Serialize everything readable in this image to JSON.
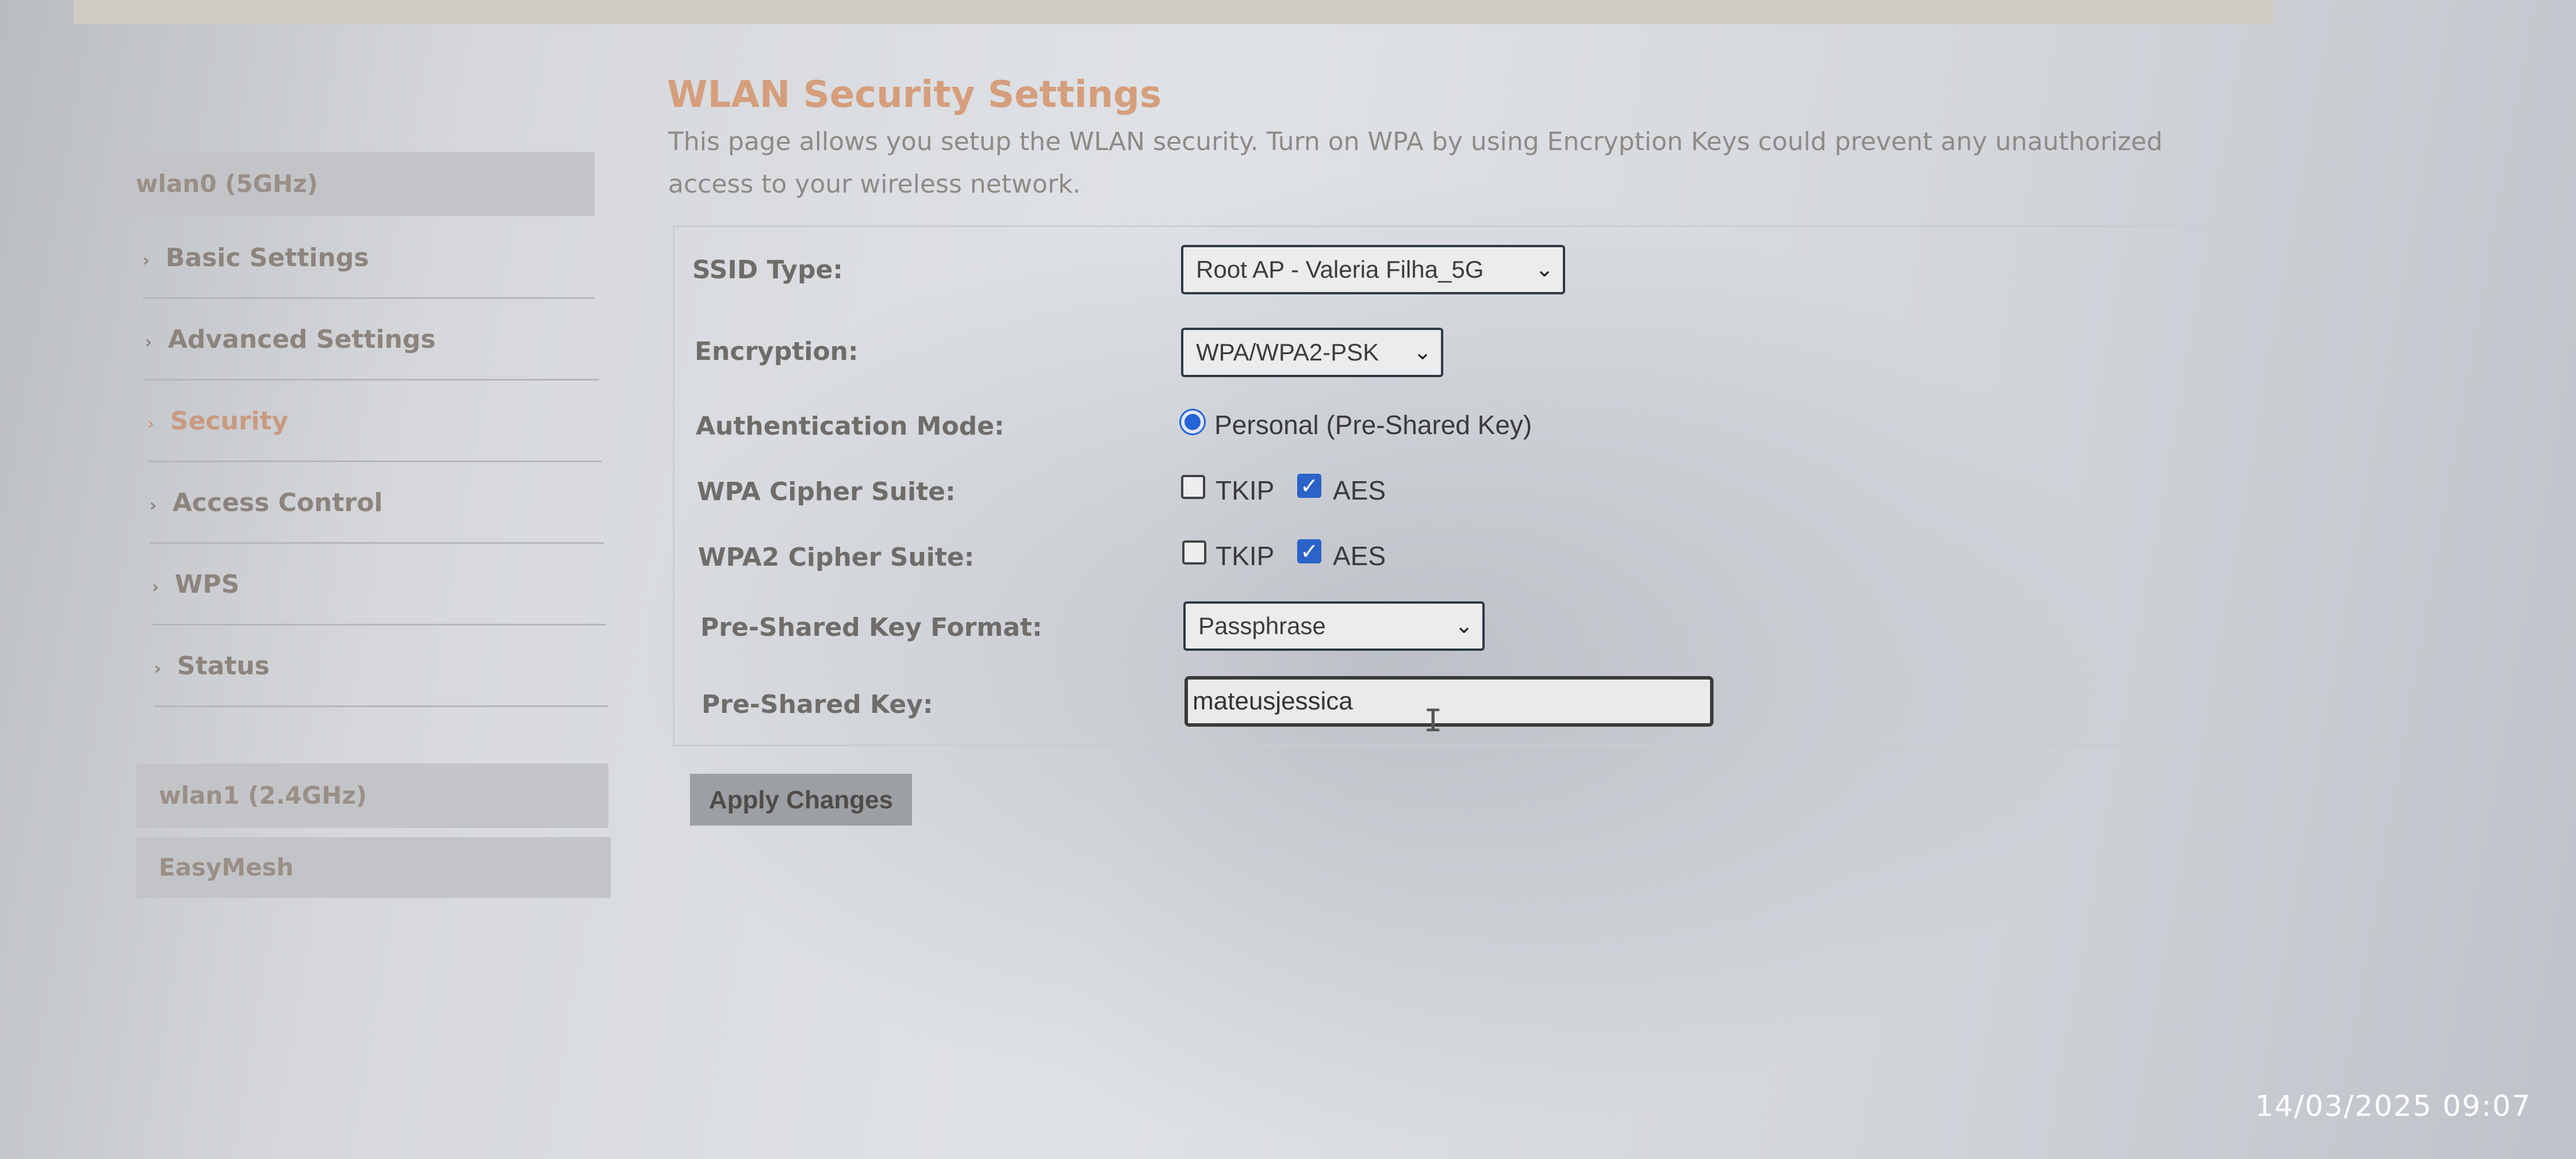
{
  "page": {
    "title": "WLAN Security Settings",
    "description": "This page allows you setup the WLAN security. Turn on WPA by using Encryption Keys could prevent any unauthorized access to your wireless network."
  },
  "sidebar": {
    "wlan0_header": "wlan0 (5GHz)",
    "items": [
      {
        "label": "Basic Settings"
      },
      {
        "label": "Advanced Settings"
      },
      {
        "label": "Security"
      },
      {
        "label": "Access Control"
      },
      {
        "label": "WPS"
      },
      {
        "label": "Status"
      }
    ],
    "wlan1_header": "wlan1 (2.4GHz)",
    "easymesh": "EasyMesh"
  },
  "form": {
    "ssid_type": {
      "label": "SSID Type:",
      "value": "Root AP - Valeria Filha_5G"
    },
    "encryption": {
      "label": "Encryption:",
      "value": "WPA/WPA2-PSK"
    },
    "auth_mode": {
      "label": "Authentication Mode:",
      "option": "Personal (Pre-Shared Key)"
    },
    "wpa_cipher": {
      "label": "WPA Cipher Suite:",
      "tkip": "TKIP",
      "aes": "AES",
      "tkip_checked": false,
      "aes_checked": true
    },
    "wpa2_cipher": {
      "label": "WPA2 Cipher Suite:",
      "tkip": "TKIP",
      "aes": "AES",
      "tkip_checked": false,
      "aes_checked": true
    },
    "psk_format": {
      "label": "Pre-Shared Key Format:",
      "value": "Passphrase"
    },
    "psk": {
      "label": "Pre-Shared Key:",
      "value": "mateusjessica"
    },
    "apply_label": "Apply Changes"
  },
  "overlay": {
    "timestamp": "14/03/2025  09:07"
  },
  "colors": {
    "title": "#d59e7c",
    "active_menu": "#c99a80",
    "checkbox_checked": "#2b63c8"
  },
  "icons": {
    "sidebar_chevron": "chevron-right-icon",
    "select_arrow": "chevron-down-icon",
    "checkmark": "checkmark-icon",
    "text_cursor": "text-cursor-icon"
  }
}
